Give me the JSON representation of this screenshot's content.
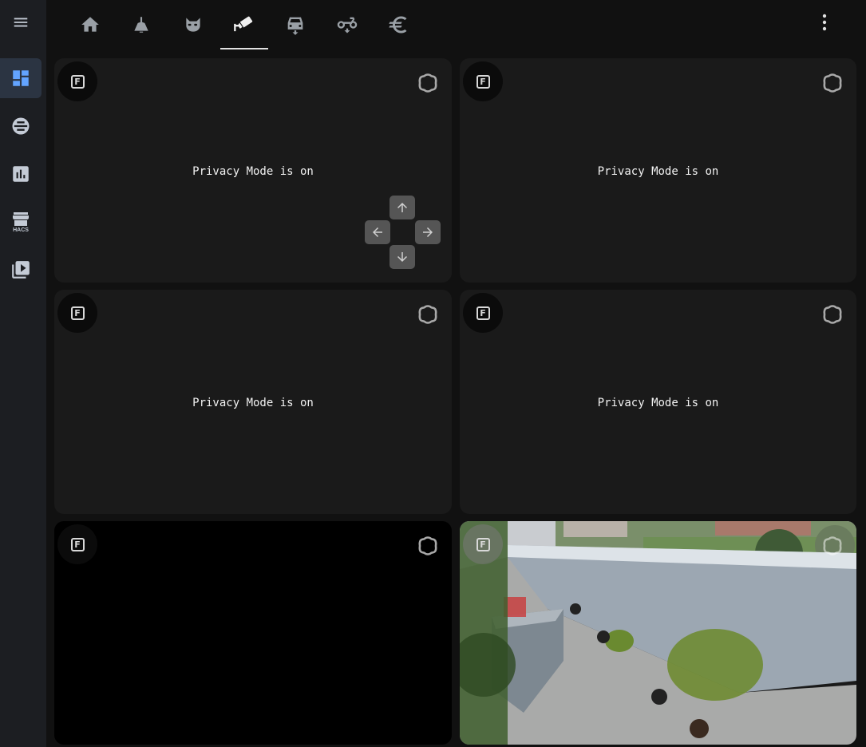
{
  "sidebar": {
    "items": [
      {
        "name": "menu",
        "icon": "menu-icon"
      },
      {
        "name": "overview",
        "icon": "dashboard-icon",
        "active": true
      },
      {
        "name": "energy",
        "icon": "energy-icon"
      },
      {
        "name": "history",
        "icon": "chart-icon"
      },
      {
        "name": "hacs",
        "icon": "hacs-store-icon",
        "label": "HACS"
      },
      {
        "name": "media",
        "icon": "media-play-icon"
      }
    ]
  },
  "header": {
    "tabs": [
      {
        "name": "home",
        "icon": "home-icon"
      },
      {
        "name": "lamp",
        "icon": "lamp-icon"
      },
      {
        "name": "cat",
        "icon": "cat-icon"
      },
      {
        "name": "cctv",
        "icon": "cctv-icon",
        "active": true
      },
      {
        "name": "car",
        "icon": "car-icon"
      },
      {
        "name": "scooter",
        "icon": "scooter-icon"
      },
      {
        "name": "euro",
        "icon": "euro-icon"
      }
    ],
    "menu_icon": "dots-vertical-icon"
  },
  "cameras": [
    {
      "id": 1,
      "status": "Privacy Mode is on",
      "fit_label": "F",
      "ptz": true
    },
    {
      "id": 2,
      "status": "Privacy Mode is on",
      "fit_label": "F"
    },
    {
      "id": 3,
      "status": "Privacy Mode is on",
      "fit_label": "F"
    },
    {
      "id": 4,
      "status": "Privacy Mode is on",
      "fit_label": "F"
    },
    {
      "id": 5,
      "status": "",
      "fit_label": "F",
      "feed": "black"
    },
    {
      "id": 6,
      "status": "",
      "fit_label": "F",
      "feed": "terrace-live-image"
    }
  ],
  "colors": {
    "background": "#111111",
    "sidebar": "#1c1e22",
    "card": "#1a1a1a",
    "icon": "#9aa0a6",
    "sidebar_icon": "#c4cbd6",
    "active_sidebar_icon": "#63a4ff",
    "ptz_button": "#555555"
  }
}
